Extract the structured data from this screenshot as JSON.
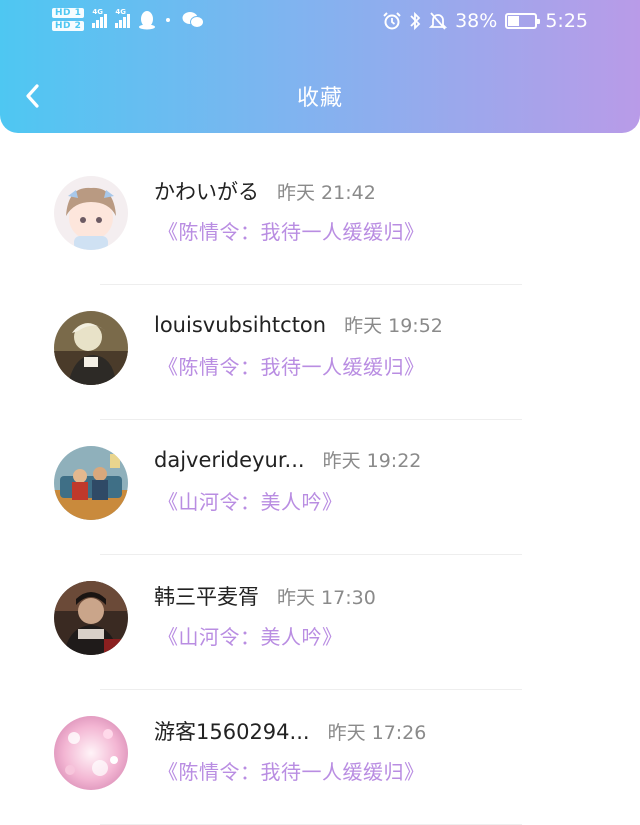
{
  "status_bar": {
    "hd1": "HD 1",
    "hd2": "HD 2",
    "net1": "4G",
    "net2": "4G",
    "battery_percent": "38%",
    "battery_level": 0.38,
    "time": "5:25",
    "icons": [
      "qq-icon",
      "wechat-icon",
      "alarm-icon",
      "bluetooth-icon",
      "mute-icon",
      "battery-icon"
    ]
  },
  "header": {
    "title": "收藏",
    "gradient": [
      "#4ec7f2",
      "#b99be8"
    ]
  },
  "accent": "#b98de2",
  "items": [
    {
      "name": "かわいがる",
      "time": "昨天 21:42",
      "work": "《陈情令：我待一人缓缓归》"
    },
    {
      "name": "louisvubsihtcton",
      "time": "昨天 19:52",
      "work": "《陈情令：我待一人缓缓归》"
    },
    {
      "name": "dajverideyur...",
      "time": "昨天 19:22",
      "work": "《山河令：美人吟》"
    },
    {
      "name": "韩三平麦胥",
      "time": "昨天 17:30",
      "work": "《山河令：美人吟》"
    },
    {
      "name": "游客1560294...",
      "time": "昨天 17:26",
      "work": "《陈情令：我待一人缓缓归》"
    }
  ]
}
